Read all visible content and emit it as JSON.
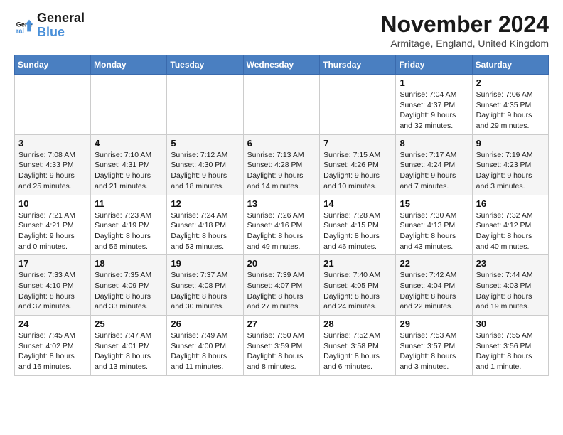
{
  "logo": {
    "line1": "General",
    "line2": "Blue"
  },
  "title": "November 2024",
  "location": "Armitage, England, United Kingdom",
  "days_of_week": [
    "Sunday",
    "Monday",
    "Tuesday",
    "Wednesday",
    "Thursday",
    "Friday",
    "Saturday"
  ],
  "weeks": [
    [
      {
        "day": "",
        "info": ""
      },
      {
        "day": "",
        "info": ""
      },
      {
        "day": "",
        "info": ""
      },
      {
        "day": "",
        "info": ""
      },
      {
        "day": "",
        "info": ""
      },
      {
        "day": "1",
        "info": "Sunrise: 7:04 AM\nSunset: 4:37 PM\nDaylight: 9 hours and 32 minutes."
      },
      {
        "day": "2",
        "info": "Sunrise: 7:06 AM\nSunset: 4:35 PM\nDaylight: 9 hours and 29 minutes."
      }
    ],
    [
      {
        "day": "3",
        "info": "Sunrise: 7:08 AM\nSunset: 4:33 PM\nDaylight: 9 hours and 25 minutes."
      },
      {
        "day": "4",
        "info": "Sunrise: 7:10 AM\nSunset: 4:31 PM\nDaylight: 9 hours and 21 minutes."
      },
      {
        "day": "5",
        "info": "Sunrise: 7:12 AM\nSunset: 4:30 PM\nDaylight: 9 hours and 18 minutes."
      },
      {
        "day": "6",
        "info": "Sunrise: 7:13 AM\nSunset: 4:28 PM\nDaylight: 9 hours and 14 minutes."
      },
      {
        "day": "7",
        "info": "Sunrise: 7:15 AM\nSunset: 4:26 PM\nDaylight: 9 hours and 10 minutes."
      },
      {
        "day": "8",
        "info": "Sunrise: 7:17 AM\nSunset: 4:24 PM\nDaylight: 9 hours and 7 minutes."
      },
      {
        "day": "9",
        "info": "Sunrise: 7:19 AM\nSunset: 4:23 PM\nDaylight: 9 hours and 3 minutes."
      }
    ],
    [
      {
        "day": "10",
        "info": "Sunrise: 7:21 AM\nSunset: 4:21 PM\nDaylight: 9 hours and 0 minutes."
      },
      {
        "day": "11",
        "info": "Sunrise: 7:23 AM\nSunset: 4:19 PM\nDaylight: 8 hours and 56 minutes."
      },
      {
        "day": "12",
        "info": "Sunrise: 7:24 AM\nSunset: 4:18 PM\nDaylight: 8 hours and 53 minutes."
      },
      {
        "day": "13",
        "info": "Sunrise: 7:26 AM\nSunset: 4:16 PM\nDaylight: 8 hours and 49 minutes."
      },
      {
        "day": "14",
        "info": "Sunrise: 7:28 AM\nSunset: 4:15 PM\nDaylight: 8 hours and 46 minutes."
      },
      {
        "day": "15",
        "info": "Sunrise: 7:30 AM\nSunset: 4:13 PM\nDaylight: 8 hours and 43 minutes."
      },
      {
        "day": "16",
        "info": "Sunrise: 7:32 AM\nSunset: 4:12 PM\nDaylight: 8 hours and 40 minutes."
      }
    ],
    [
      {
        "day": "17",
        "info": "Sunrise: 7:33 AM\nSunset: 4:10 PM\nDaylight: 8 hours and 37 minutes."
      },
      {
        "day": "18",
        "info": "Sunrise: 7:35 AM\nSunset: 4:09 PM\nDaylight: 8 hours and 33 minutes."
      },
      {
        "day": "19",
        "info": "Sunrise: 7:37 AM\nSunset: 4:08 PM\nDaylight: 8 hours and 30 minutes."
      },
      {
        "day": "20",
        "info": "Sunrise: 7:39 AM\nSunset: 4:07 PM\nDaylight: 8 hours and 27 minutes."
      },
      {
        "day": "21",
        "info": "Sunrise: 7:40 AM\nSunset: 4:05 PM\nDaylight: 8 hours and 24 minutes."
      },
      {
        "day": "22",
        "info": "Sunrise: 7:42 AM\nSunset: 4:04 PM\nDaylight: 8 hours and 22 minutes."
      },
      {
        "day": "23",
        "info": "Sunrise: 7:44 AM\nSunset: 4:03 PM\nDaylight: 8 hours and 19 minutes."
      }
    ],
    [
      {
        "day": "24",
        "info": "Sunrise: 7:45 AM\nSunset: 4:02 PM\nDaylight: 8 hours and 16 minutes."
      },
      {
        "day": "25",
        "info": "Sunrise: 7:47 AM\nSunset: 4:01 PM\nDaylight: 8 hours and 13 minutes."
      },
      {
        "day": "26",
        "info": "Sunrise: 7:49 AM\nSunset: 4:00 PM\nDaylight: 8 hours and 11 minutes."
      },
      {
        "day": "27",
        "info": "Sunrise: 7:50 AM\nSunset: 3:59 PM\nDaylight: 8 hours and 8 minutes."
      },
      {
        "day": "28",
        "info": "Sunrise: 7:52 AM\nSunset: 3:58 PM\nDaylight: 8 hours and 6 minutes."
      },
      {
        "day": "29",
        "info": "Sunrise: 7:53 AM\nSunset: 3:57 PM\nDaylight: 8 hours and 3 minutes."
      },
      {
        "day": "30",
        "info": "Sunrise: 7:55 AM\nSunset: 3:56 PM\nDaylight: 8 hours and 1 minute."
      }
    ]
  ]
}
